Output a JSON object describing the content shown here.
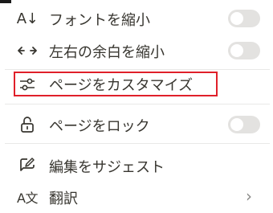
{
  "menu": {
    "items": [
      {
        "label": "フォントを縮小",
        "icon": "font-size-icon",
        "icon_text": "A↓",
        "toggle": "off"
      },
      {
        "label": "左右の余白を縮小",
        "icon": "width-arrows-icon",
        "icon_text": "↔",
        "toggle": "off"
      },
      {
        "label": "ページをカスタマイズ",
        "icon": "sliders-icon",
        "highlighted": true,
        "highlight_color": "#e0202a"
      },
      {
        "label": "ページをロック",
        "icon": "unlock-icon",
        "toggle": "off"
      },
      {
        "label": "編集をサジェスト",
        "icon": "suggest-edit-icon"
      },
      {
        "label": "翻訳",
        "icon": "translate-icon",
        "icon_text": "A文",
        "has_submenu": true
      }
    ]
  }
}
